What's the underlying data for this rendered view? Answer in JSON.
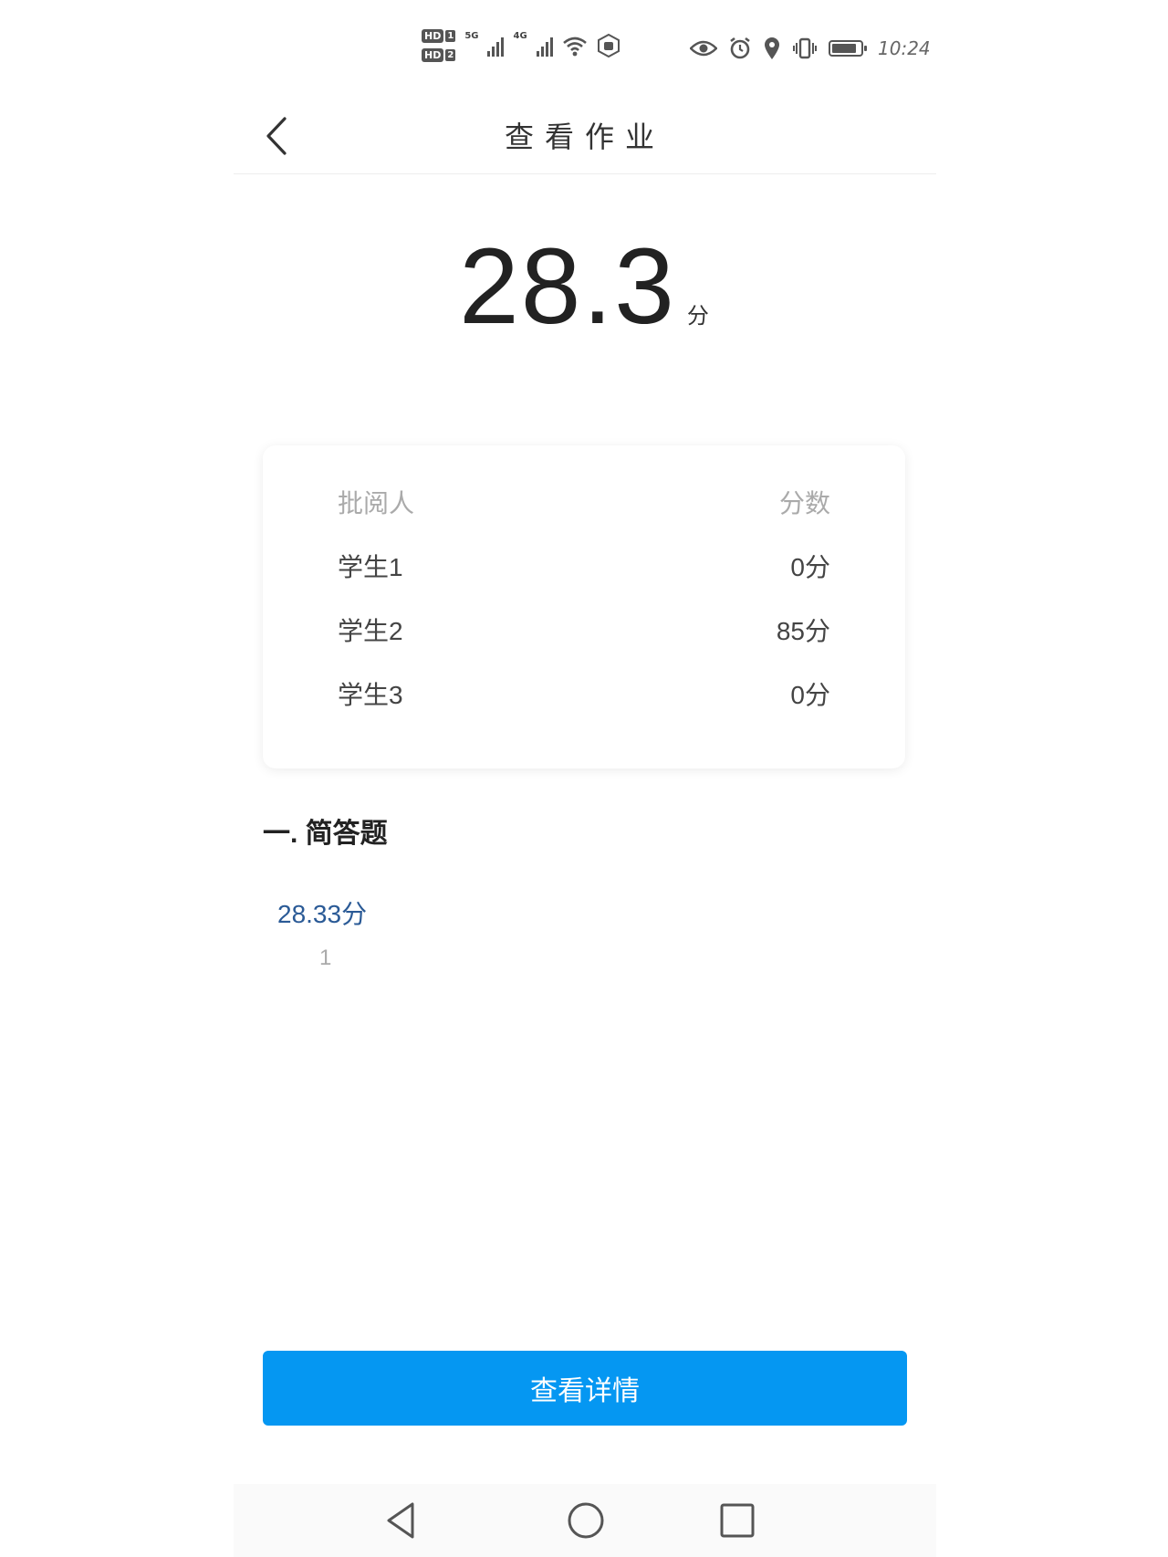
{
  "status_bar": {
    "time": "10:24",
    "sim1_label": "HD",
    "sim1_num": "1",
    "sim2_label": "HD",
    "sim2_num": "2",
    "net1": "5G",
    "net2": "4G",
    "icons": [
      "eye-icon",
      "alarm-icon",
      "location-icon",
      "vibrate-icon",
      "battery-icon",
      "wifi-icon",
      "hand-icon"
    ]
  },
  "header": {
    "title": "查看作业"
  },
  "summary": {
    "score": "28.3",
    "unit": "分"
  },
  "graders": {
    "col_grader": "批阅人",
    "col_score": "分数",
    "rows": [
      {
        "name": "学生1",
        "score": "0分"
      },
      {
        "name": "学生2",
        "score": "85分"
      },
      {
        "name": "学生3",
        "score": "0分"
      }
    ]
  },
  "section": {
    "title": "一. 简答题",
    "question_score": "28.33分",
    "question_number": "1"
  },
  "actions": {
    "detail_label": "查看详情"
  },
  "colors": {
    "accent": "#0597f2",
    "score_link": "#2a5a96"
  }
}
